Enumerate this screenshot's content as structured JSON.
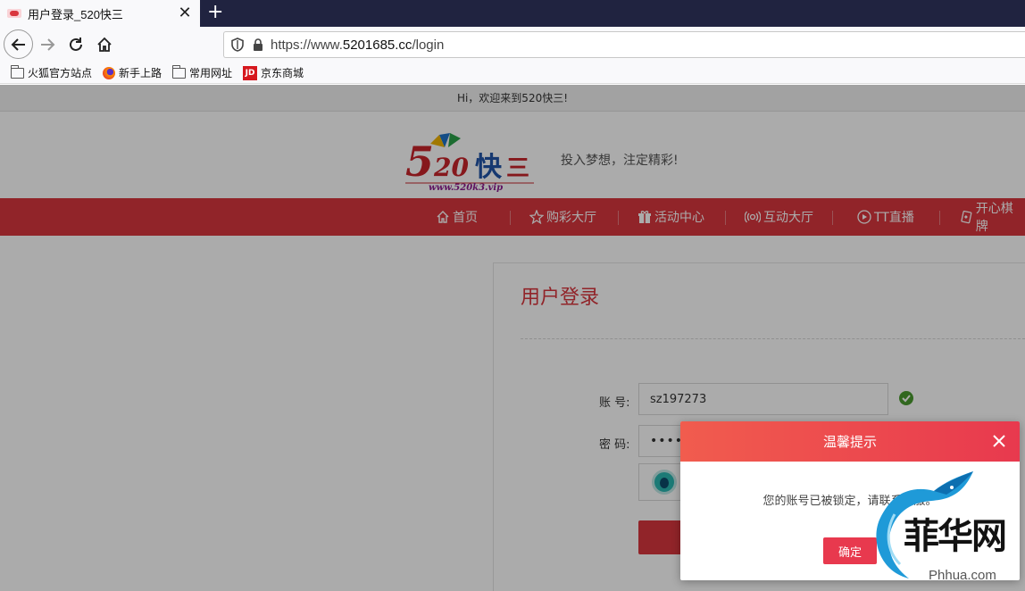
{
  "browser": {
    "tab_title": "用户登录_520快三",
    "url_prefix": "https://www.",
    "url_host": "5201685.cc",
    "url_path": "/login",
    "bookmarks": [
      "火狐官方站点",
      "新手上路",
      "常用网址",
      "京东商城"
    ]
  },
  "site": {
    "welcome": "Hi，欢迎来到520快三!",
    "slogan": "投入梦想，注定精彩!",
    "logo_main": "520快三",
    "logo_url": "www.520k3.vip",
    "nav": [
      "首页",
      "购彩大厅",
      "活动中心",
      "互动大厅",
      "TT直播",
      "开心棋牌"
    ]
  },
  "login": {
    "title": "用户登录",
    "account_label": "账 号:",
    "account_value": "sz197273",
    "password_label": "密 码:",
    "password_mask": "•••••"
  },
  "dialog": {
    "title": "温馨提示",
    "message": "您的账号已被锁定，请联系客服。",
    "ok_label": "确定"
  },
  "watermark": {
    "text": "菲华网",
    "url": "Phhua.com"
  },
  "colors": {
    "brand_red": "#d9363e",
    "dialog_red": "#e8394e",
    "tab_bar": "#202340"
  }
}
